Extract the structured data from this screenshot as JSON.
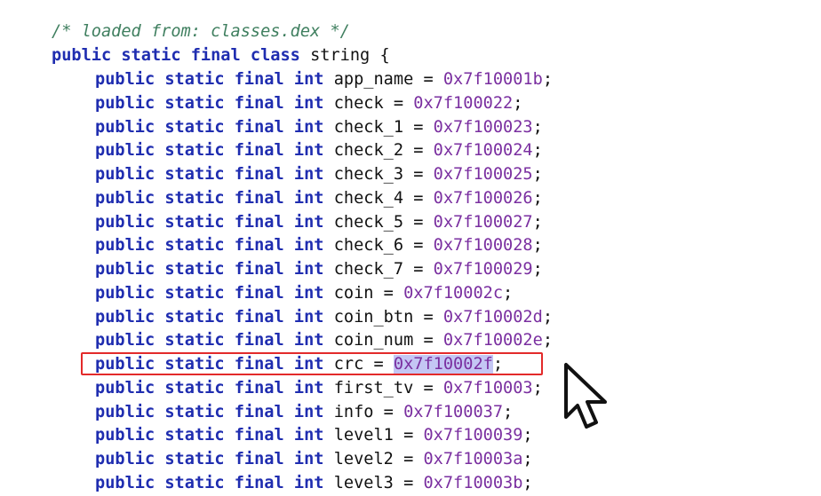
{
  "editor": {
    "comment": "/* loaded from: classes.dex */",
    "class_decl": {
      "keywords": "public static final class",
      "name": "string",
      "brace": "{"
    },
    "field_keywords": "public static final",
    "field_type": "int",
    "fields": [
      {
        "name": "app_name",
        "value": "0x7f10001b"
      },
      {
        "name": "check",
        "value": "0x7f100022"
      },
      {
        "name": "check_1",
        "value": "0x7f100023"
      },
      {
        "name": "check_2",
        "value": "0x7f100024"
      },
      {
        "name": "check_3",
        "value": "0x7f100025"
      },
      {
        "name": "check_4",
        "value": "0x7f100026"
      },
      {
        "name": "check_5",
        "value": "0x7f100027"
      },
      {
        "name": "check_6",
        "value": "0x7f100028"
      },
      {
        "name": "check_7",
        "value": "0x7f100029"
      },
      {
        "name": "coin",
        "value": "0x7f10002c"
      },
      {
        "name": "coin_btn",
        "value": "0x7f10002d"
      },
      {
        "name": "coin_num",
        "value": "0x7f10002e"
      },
      {
        "name": "crc",
        "value": "0x7f10002f",
        "highlighted": true
      },
      {
        "name": "first_tv",
        "value": "0x7f10003"
      },
      {
        "name": "info",
        "value": "0x7f100037"
      },
      {
        "name": "level1",
        "value": "0x7f100039"
      },
      {
        "name": "level2",
        "value": "0x7f10003a"
      },
      {
        "name": "level3",
        "value": "0x7f10003b"
      }
    ]
  },
  "colors": {
    "keyword": "#1f2db0",
    "comment": "#3f7f5f",
    "number": "#7a2fa0",
    "selection": "#c4c6f4",
    "highlight_box": "#e32a2a"
  },
  "icons": {
    "cursor": "mouse-pointer-icon"
  }
}
